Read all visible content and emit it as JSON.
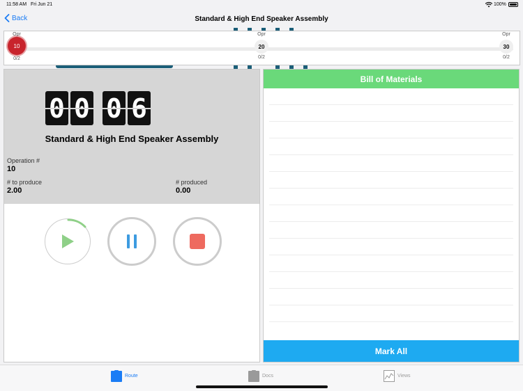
{
  "status": {
    "time": "11:58 AM",
    "date": "Fri Jun 21",
    "battery": "100%"
  },
  "nav": {
    "back_label": "Back",
    "title": "Standard & High End Speaker Assembly"
  },
  "route": {
    "ops": [
      {
        "label": "Opr",
        "number": "10",
        "count": "0/2",
        "active": true
      },
      {
        "label": "Opr",
        "number": "20",
        "count": "0/2",
        "active": false
      },
      {
        "label": "Opr",
        "number": "30",
        "count": "0/2",
        "active": false
      }
    ]
  },
  "timer": {
    "d1": "0",
    "d2": "0",
    "d3": "0",
    "d4": "6"
  },
  "job": {
    "title": "Standard & High End Speaker Assembly",
    "operation_label": "Operation #",
    "operation_value": "10",
    "to_produce_label": "# to produce",
    "to_produce_value": "2.00",
    "produced_label": "# produced",
    "produced_value": "0.00"
  },
  "bom": {
    "header": "Bill of Materials",
    "mark_all": "Mark All"
  },
  "tabs": [
    {
      "label": "Route",
      "icon": "route-icon",
      "active": true
    },
    {
      "label": "Docs",
      "icon": "docs-icon",
      "active": false
    },
    {
      "label": "Views",
      "icon": "chart-icon",
      "active": false
    }
  ],
  "colors": {
    "accent": "#1a7cf5",
    "active_op": "#c8242c",
    "bom_header": "#6ad97a",
    "mark_all": "#1eaaf1",
    "play": "#8fd088",
    "pause": "#3d9be0",
    "stop": "#ee6a5f"
  }
}
